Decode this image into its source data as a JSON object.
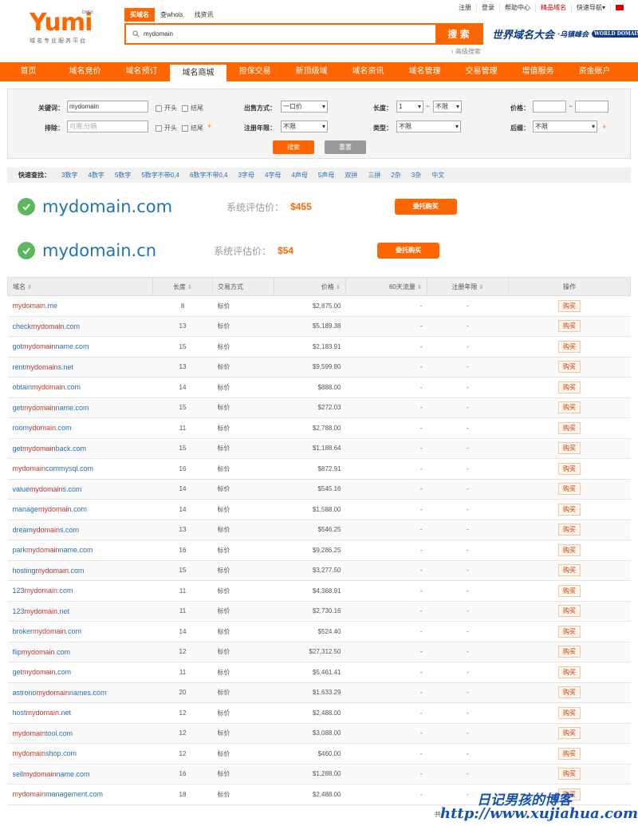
{
  "top_links": [
    "注册",
    "登录",
    "帮助中心",
    "精品域名",
    "快速导航▾"
  ],
  "logo": {
    "text": "Yumi",
    "beta": "beta",
    "subtitle": "域名专业服务平台"
  },
  "search": {
    "tabs": [
      "买域名",
      "查whois",
      "找资讯"
    ],
    "value": "mydomain",
    "button": "搜 索",
    "advanced": "› 高级搜索"
  },
  "slogan": {
    "main": "世界域名大会",
    "sub": "·乌镇峰会",
    "tag": "WORLD DOMAIN"
  },
  "nav": [
    "首页",
    "域名竞价",
    "域名预订",
    "域名商城",
    "担保交易",
    "新顶级域",
    "域名资讯",
    "域名管理",
    "交易管理",
    "增值服务",
    "资金账户"
  ],
  "filter": {
    "keyword_label": "关键词：",
    "keyword_value": "mydomain",
    "exclude_label": "排除：",
    "exclude_placeholder": "可用,分隔",
    "start_label": "开头",
    "end_label": "结尾",
    "sale_label": "出售方式：",
    "sale_value": "一口价",
    "years_label": "注册年限：",
    "years_value": "不限",
    "length_label": "长度：",
    "length_min": "1",
    "length_max": "不限",
    "type_label": "类型：",
    "type_value": "不限",
    "price_label": "价格：",
    "suffix_label": "后缀：",
    "suffix_value": "不限",
    "tilde": "~",
    "plus": "+",
    "search_btn": "搜索",
    "reset_btn": "重置"
  },
  "quick": {
    "label": "快速查找：",
    "items": [
      "3数字",
      "4数字",
      "5数字",
      "5数字不带0,4",
      "6数字不带0,4",
      "3字母",
      "4字母",
      "4声母",
      "5声母",
      "双拼",
      "三拼",
      "2杂",
      "3杂",
      "中文"
    ]
  },
  "results": [
    {
      "domain": "mydomain.com",
      "label": "系统评估价：",
      "price": "$455",
      "button": "委托购买"
    },
    {
      "domain": "mydomain.cn",
      "label": "系统评估价：",
      "price": "$54",
      "button": "委托购买"
    }
  ],
  "table": {
    "headers": [
      "域名",
      "长度",
      "交易方式",
      "价格",
      "60天流量",
      "注册年限",
      "操作"
    ],
    "rows": [
      {
        "pre": "",
        "kw": "mydomain",
        "post": ".me",
        "len": "8",
        "mode": "标价",
        "price": "$2,875.00",
        "traffic": "-",
        "years": "-",
        "action": "购买"
      },
      {
        "pre": "check",
        "kw": "mydomain",
        "post": ".com",
        "len": "13",
        "mode": "标价",
        "price": "$5,189.38",
        "traffic": "-",
        "years": "-",
        "action": "购买"
      },
      {
        "pre": "got",
        "kw": "mydomain",
        "post": "name.com",
        "len": "15",
        "mode": "标价",
        "price": "$2,183.91",
        "traffic": "-",
        "years": "-",
        "action": "购买"
      },
      {
        "pre": "rent",
        "kw": "mydomain",
        "post": "s.net",
        "len": "13",
        "mode": "标价",
        "price": "$9,599.80",
        "traffic": "-",
        "years": "-",
        "action": "购买"
      },
      {
        "pre": "obtain",
        "kw": "mydomain",
        "post": ".com",
        "len": "14",
        "mode": "标价",
        "price": "$888.00",
        "traffic": "-",
        "years": "-",
        "action": "购买"
      },
      {
        "pre": "get",
        "kw": "mydomain",
        "post": "name.com",
        "len": "15",
        "mode": "标价",
        "price": "$272.03",
        "traffic": "-",
        "years": "-",
        "action": "购买"
      },
      {
        "pre": "room",
        "kw": "ydomain",
        "post": ".com",
        "len": "11",
        "mode": "标价",
        "price": "$2,788.00",
        "traffic": "-",
        "years": "-",
        "action": "购买"
      },
      {
        "pre": "get",
        "kw": "mydomain",
        "post": "back.com",
        "len": "15",
        "mode": "标价",
        "price": "$1,188.64",
        "traffic": "-",
        "years": "-",
        "action": "购买"
      },
      {
        "pre": "",
        "kw": "mydomain",
        "post": "commysql.com",
        "len": "16",
        "mode": "标价",
        "price": "$872.91",
        "traffic": "-",
        "years": "-",
        "action": "购买"
      },
      {
        "pre": "value",
        "kw": "mydomain",
        "post": "s.com",
        "len": "14",
        "mode": "标价",
        "price": "$545.16",
        "traffic": "-",
        "years": "-",
        "action": "购买"
      },
      {
        "pre": "manage",
        "kw": "mydomain",
        "post": ".com",
        "len": "14",
        "mode": "标价",
        "price": "$1,588.00",
        "traffic": "-",
        "years": "-",
        "action": "购买"
      },
      {
        "pre": "dream",
        "kw": "ydomain",
        "post": "s.com",
        "len": "13",
        "mode": "标价",
        "price": "$546.25",
        "traffic": "-",
        "years": "-",
        "action": "购买"
      },
      {
        "pre": "park",
        "kw": "mydomain",
        "post": "name.com",
        "len": "16",
        "mode": "标价",
        "price": "$9,286.25",
        "traffic": "-",
        "years": "-",
        "action": "购买"
      },
      {
        "pre": "hosting",
        "kw": "mydomain",
        "post": ".com",
        "len": "15",
        "mode": "标价",
        "price": "$3,277.50",
        "traffic": "-",
        "years": "-",
        "action": "购买"
      },
      {
        "pre": "123",
        "kw": "mydomain",
        "post": ".com",
        "len": "11",
        "mode": "标价",
        "price": "$4,368.91",
        "traffic": "-",
        "years": "-",
        "action": "购买"
      },
      {
        "pre": "123",
        "kw": "mydomain",
        "post": ".net",
        "len": "11",
        "mode": "标价",
        "price": "$2,730.16",
        "traffic": "-",
        "years": "-",
        "action": "购买"
      },
      {
        "pre": "broker",
        "kw": "mydomain",
        "post": ".com",
        "len": "14",
        "mode": "标价",
        "price": "$524.40",
        "traffic": "-",
        "years": "-",
        "action": "购买"
      },
      {
        "pre": "flip",
        "kw": "mydomain",
        "post": ".com",
        "len": "12",
        "mode": "标价",
        "price": "$27,312.50",
        "traffic": "-",
        "years": "-",
        "action": "购买"
      },
      {
        "pre": "get",
        "kw": "mydomain",
        "post": ".com",
        "len": "11",
        "mode": "标价",
        "price": "$5,461.41",
        "traffic": "-",
        "years": "-",
        "action": "购买"
      },
      {
        "pre": "astrono",
        "kw": "mydomain",
        "post": "names.com",
        "len": "20",
        "mode": "标价",
        "price": "$1,633.29",
        "traffic": "-",
        "years": "-",
        "action": "购买"
      },
      {
        "pre": "host",
        "kw": "mydomain",
        "post": ".net",
        "len": "12",
        "mode": "标价",
        "price": "$2,488.00",
        "traffic": "-",
        "years": "-",
        "action": "购买"
      },
      {
        "pre": "",
        "kw": "mydomain",
        "post": "tool.com",
        "len": "12",
        "mode": "标价",
        "price": "$3,088.00",
        "traffic": "-",
        "years": "-",
        "action": "购买"
      },
      {
        "pre": "",
        "kw": "mydomain",
        "post": "shop.com",
        "len": "12",
        "mode": "标价",
        "price": "$460.00",
        "traffic": "-",
        "years": "-",
        "action": "购买"
      },
      {
        "pre": "sell",
        "kw": "mydomain",
        "post": "name.com",
        "len": "16",
        "mode": "标价",
        "price": "$1,288.00",
        "traffic": "-",
        "years": "-",
        "action": "购买"
      },
      {
        "pre": "",
        "kw": "mydomain",
        "post": "management.com",
        "len": "18",
        "mode": "标价",
        "price": "$2,488.00",
        "traffic": "-",
        "years": "-",
        "action": "购买"
      }
    ]
  },
  "footer": {
    "text": "共"
  },
  "watermark": {
    "line1": "日记男孩的博客",
    "line2": "http://www.xujiahua.com"
  },
  "colors": {
    "accent": "#ff6600",
    "link": "#2a6fb5",
    "keyword": "#c0392b",
    "ok": "#5cb85c"
  }
}
